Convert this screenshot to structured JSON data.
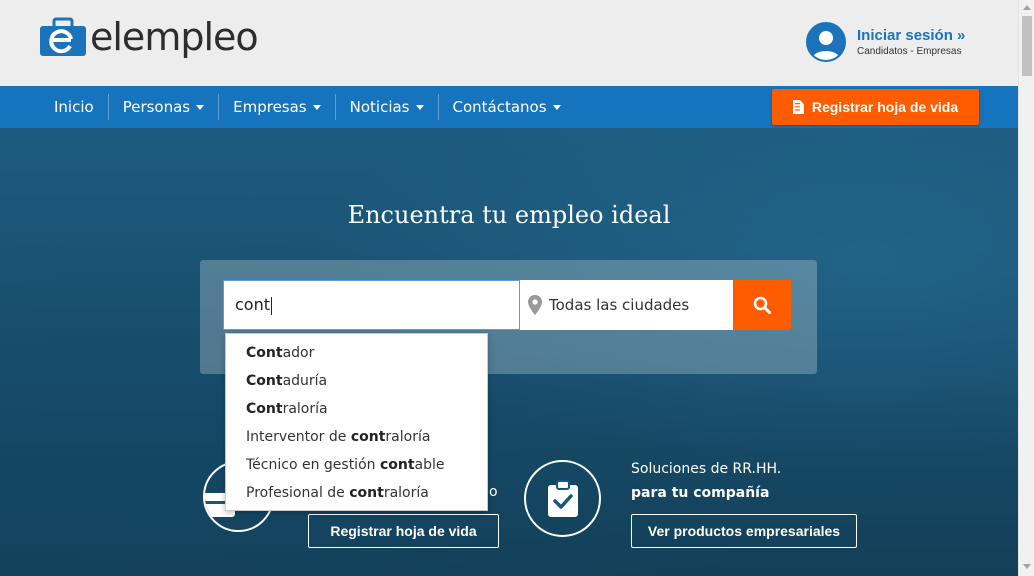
{
  "header": {
    "logo_text": "elempleo",
    "login_title": "Iniciar sesión »",
    "login_subtitle": "Candidatos - Empresas"
  },
  "nav": {
    "items": [
      {
        "label": "Inicio",
        "dropdown": false
      },
      {
        "label": "Personas",
        "dropdown": true
      },
      {
        "label": "Empresas",
        "dropdown": true
      },
      {
        "label": "Noticias",
        "dropdown": true
      },
      {
        "label": "Contáctanos",
        "dropdown": true
      }
    ],
    "register_label": "Registrar hoja de vida"
  },
  "hero": {
    "title": "Encuentra tu empleo ideal",
    "keyword_value": "cont",
    "city_value": "Todas las ciudades"
  },
  "suggestions": [
    {
      "match": "Cont",
      "rest": "ador",
      "prefix": ""
    },
    {
      "match": "Cont",
      "rest": "aduría",
      "prefix": ""
    },
    {
      "match": "Cont",
      "rest": "raloría",
      "prefix": ""
    },
    {
      "prefix": "Interventor de ",
      "match": "cont",
      "rest": "raloría"
    },
    {
      "prefix": "Técnico en gestión ",
      "match": "cont",
      "rest": "able"
    },
    {
      "prefix": "Profesional de ",
      "match": "cont",
      "rest": "raloría"
    }
  ],
  "lower": {
    "left_partial": "o",
    "left_button": "Registrar hoja de vida",
    "right_title": "Soluciones de RR.HH.",
    "right_subtitle": "para tu compañía",
    "right_button": "Ver productos empresariales"
  },
  "colors": {
    "brand_blue": "#1673bd",
    "accent_orange": "#ff5c00"
  }
}
